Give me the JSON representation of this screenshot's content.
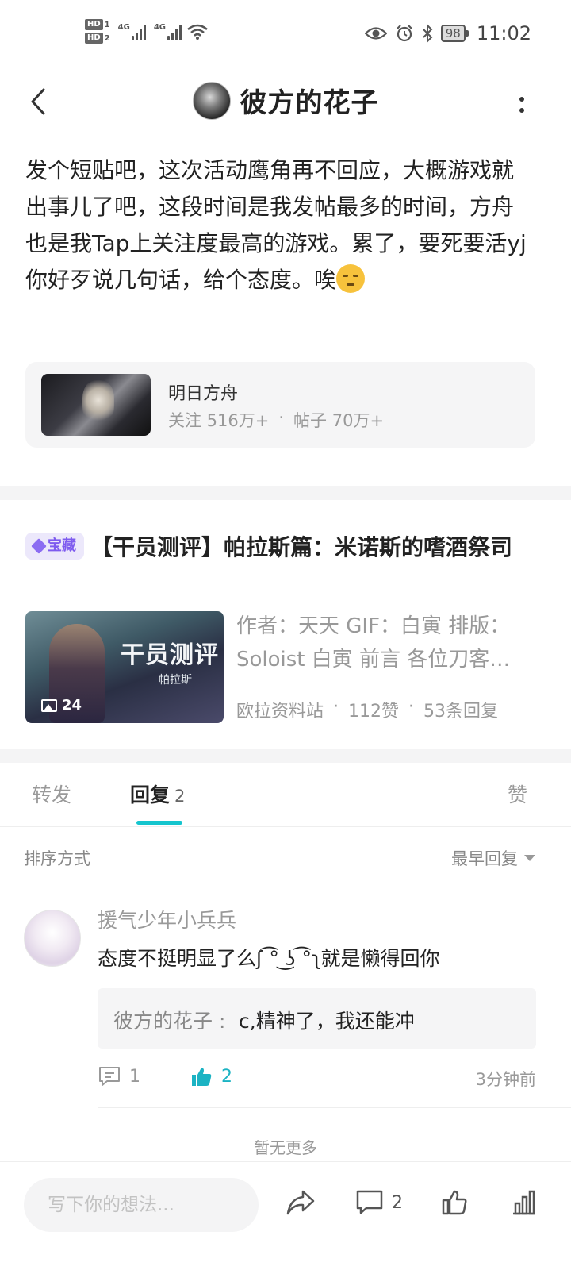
{
  "status_bar": {
    "sim1": "HD",
    "sim1_num": "1",
    "sim2": "HD",
    "sim2_num": "2",
    "net1": "4G",
    "net2": "4G",
    "battery": "98",
    "time": "11:02"
  },
  "header": {
    "username": "彼方的花子"
  },
  "post": {
    "text": "发个短贴吧，这次活动鹰角再不回应，大概游戏就出事儿了吧，这段时间是我发帖最多的时间，方舟也是我Tap上关注度最高的游戏。累了，要死要活yj你好歹说几句话，给个态度。唉",
    "game": {
      "name": "明日方舟",
      "followers": "关注 516万+",
      "sep": "·",
      "posts": "帖子 70万+"
    }
  },
  "linked_article": {
    "badge": "宝藏",
    "title": "【干员测评】帕拉斯篇：米诺斯的嗜酒祭司",
    "image_banner": "干员测评",
    "image_sub": "帕拉斯",
    "image_count": "24",
    "excerpt": "作者：天天 GIF：白寅 排版：Soloist 白寅 前言 各位刀客…",
    "source": "欧拉资料站",
    "likes": "112赞",
    "replies": "53条回复",
    "sep": "·"
  },
  "tabs": {
    "repost": "转发",
    "reply": "回复",
    "reply_count": "2",
    "like": "赞"
  },
  "sort": {
    "label": "排序方式",
    "value": "最早回复"
  },
  "comments": [
    {
      "user": "援气少年小兵兵",
      "text": "态度不挺明显了么ʃ ͡° ͜ʖ ͡°ʅ就是懒得回你",
      "reply_author": "彼方的花子 :",
      "reply_text": "c,精神了，我还能冲",
      "reply_count": "1",
      "like_count": "2",
      "time": "3分钟前"
    }
  ],
  "no_more": "暂无更多",
  "bottom_bar": {
    "input_placeholder": "写下你的想法...",
    "comment_count": "2"
  },
  "colors": {
    "accent": "#15c5ce",
    "badge_purple": "#7e5bef"
  }
}
